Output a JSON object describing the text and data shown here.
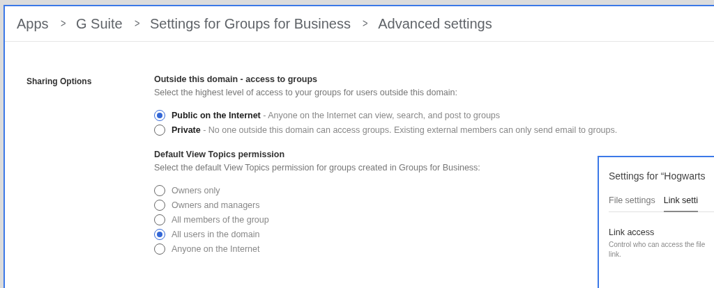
{
  "breadcrumbs": [
    {
      "label": "Apps"
    },
    {
      "label": "G Suite"
    },
    {
      "label": "Settings for Groups for Business"
    },
    {
      "label": "Advanced settings"
    }
  ],
  "separator": ">",
  "section": {
    "label": "Sharing Options"
  },
  "groups": [
    {
      "title": "Outside this domain - access to groups",
      "description": "Select the highest level of access to your groups for users outside this domain:",
      "options": [
        {
          "label": "Public on the Internet",
          "detail": " - Anyone on the Internet can view, search, and post to groups",
          "selected": true
        },
        {
          "label": "Private",
          "detail": " - No one outside this domain can access groups. Existing external members can only send email to groups.",
          "selected": false
        }
      ]
    },
    {
      "title": "Default View Topics permission",
      "description": "Select the default View Topics permission for groups created in Groups for Business:",
      "options": [
        {
          "label": "Owners only",
          "selected": false
        },
        {
          "label": "Owners and managers",
          "selected": false
        },
        {
          "label": "All members of the group",
          "selected": false
        },
        {
          "label": "All users in the domain",
          "selected": true
        },
        {
          "label": "Anyone on the Internet",
          "selected": false
        }
      ]
    }
  ],
  "dialog": {
    "title": "Settings for “Hogwarts",
    "tabs": [
      {
        "label": "File settings",
        "selected": false
      },
      {
        "label": "Link setti",
        "selected": true
      }
    ],
    "heading": "Link access",
    "description_lines": [
      "Control who can access the file",
      "link."
    ]
  }
}
